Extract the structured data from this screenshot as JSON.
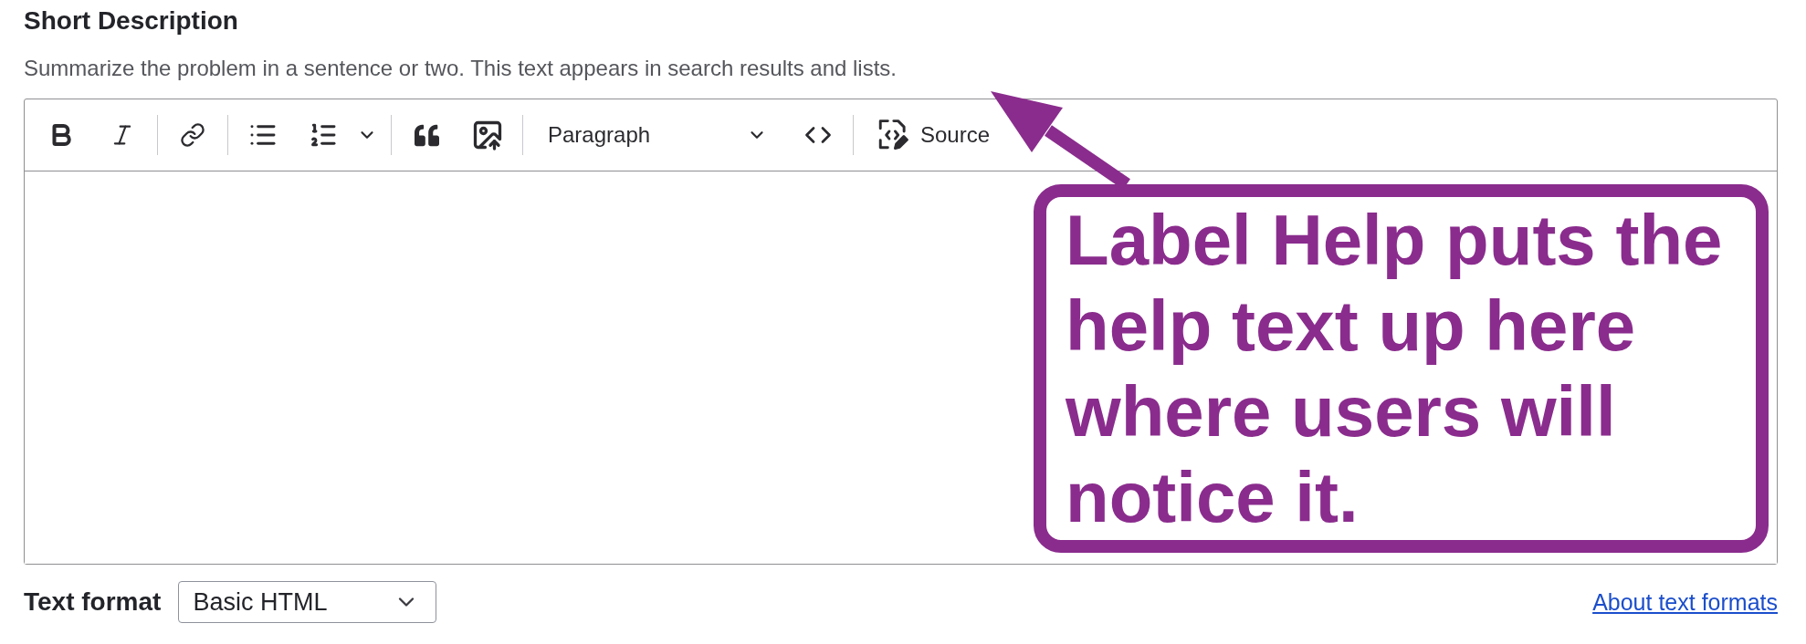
{
  "field": {
    "label": "Short Description",
    "description": "Summarize the problem in a sentence or two. This text appears in search results and lists."
  },
  "toolbar": {
    "heading_dropdown": "Paragraph",
    "source_button": "Source"
  },
  "text_format": {
    "label": "Text format",
    "value": "Basic HTML",
    "help_link": "About text formats"
  },
  "annotation": {
    "text": "Label Help puts the help text up here where users will notice it."
  }
}
